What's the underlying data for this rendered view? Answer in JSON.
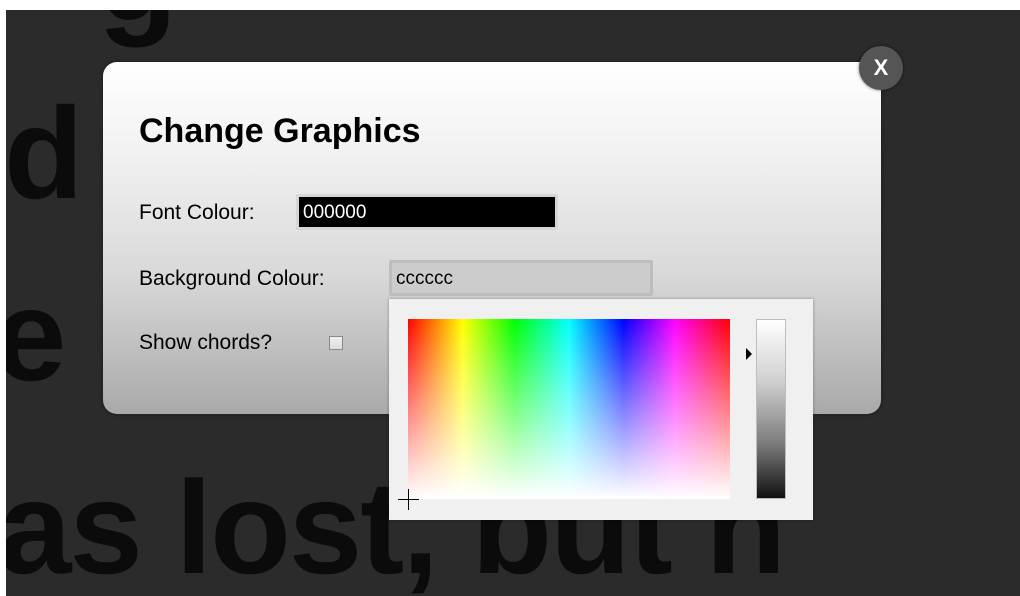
{
  "background": {
    "lines": [
      "g",
      "d",
      "e          n li",
      "as lost, but n"
    ]
  },
  "dialog": {
    "title": "Change Graphics",
    "close_label": "X",
    "font_colour": {
      "label": "Font Colour:",
      "value": "000000"
    },
    "background_colour": {
      "label": "Background Colour:",
      "value": "cccccc"
    },
    "show_chords": {
      "label": "Show chords?",
      "checked": false
    }
  },
  "colour_picker": {
    "selected_hex": "cccccc",
    "hue_field_icon": "crosshair-icon",
    "value_marker_icon": "triangle-right-icon"
  },
  "colors": {
    "font_colour_swatch": "#000000",
    "background_colour_swatch": "#cccccc",
    "overlay": "#2b2b2b"
  }
}
